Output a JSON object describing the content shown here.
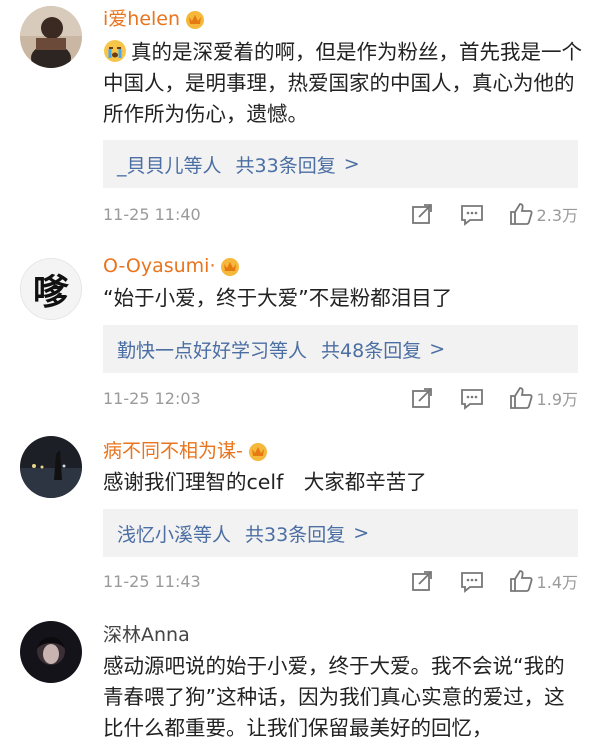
{
  "comments": [
    {
      "username": "i爱helen",
      "text": "真的是深爱着的啊，但是作为粉丝，首先我是一个中国人，是明事理，热爱国家的中国人，真心为他的所作所为伤心，遗憾。",
      "emoji_icon": "crying-face-icon",
      "replies": {
        "names": "_貝貝儿等人",
        "count": "共33条回复",
        "arrow": ">"
      },
      "time": "11-25 11:40",
      "likes": "2.3万"
    },
    {
      "username": "O-Oyasumi·",
      "avatar_text": "嗲",
      "text": "“始于小爱，终于大爱”不是粉都泪目了",
      "replies": {
        "names": "勤快一点好好学习等人",
        "count": "共48条回复",
        "arrow": ">"
      },
      "time": "11-25 12:03",
      "likes": "1.9万"
    },
    {
      "username": "病不同不相为谋-",
      "text": "感谢我们理智的celf　大家都辛苦了",
      "replies": {
        "names": "浅忆小溪等人",
        "count": "共33条回复",
        "arrow": ">"
      },
      "time": "11-25 11:43",
      "likes": "1.4万"
    },
    {
      "username": "深林Anna",
      "text": "感动源吧说的始于小爱，终于大爱。我不会说“我的青春喂了狗”这种话，因为我们真心实意的爱过，这比什么都重要。让我们保留最美好的回忆，"
    }
  ],
  "colors": {
    "username": "#e9741d",
    "link": "#4b6ea3",
    "meta": "#9a9a9a",
    "reply_bg": "#f2f2f2"
  }
}
